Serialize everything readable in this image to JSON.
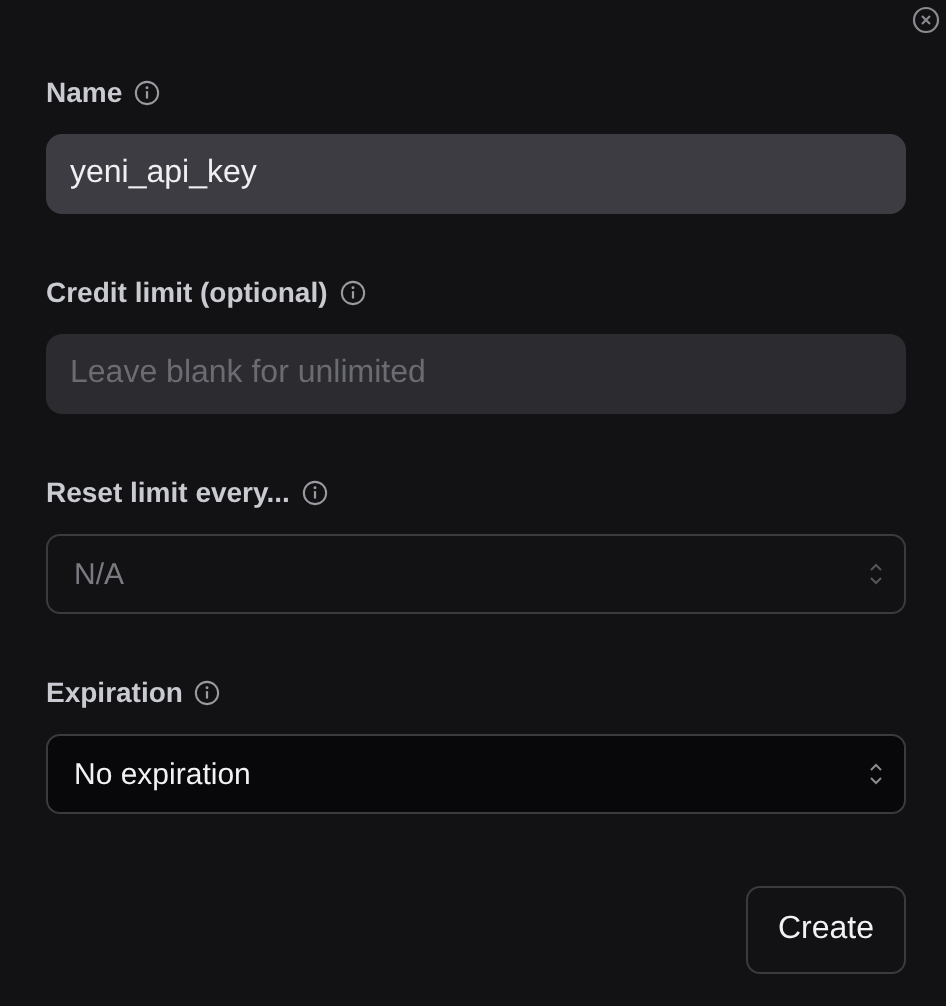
{
  "fields": [
    {
      "kind": "input",
      "label": "Name",
      "value": "yeni_api_key",
      "disabled": false
    },
    {
      "kind": "input",
      "label": "Credit limit (optional)",
      "placeholder": "Leave blank for unlimited",
      "disabled": false
    },
    {
      "kind": "select",
      "label": "Reset limit every...",
      "value": "N/A",
      "disabled": true
    },
    {
      "kind": "select",
      "label": "Expiration",
      "value": "No expiration",
      "disabled": false
    }
  ],
  "button": "Create"
}
